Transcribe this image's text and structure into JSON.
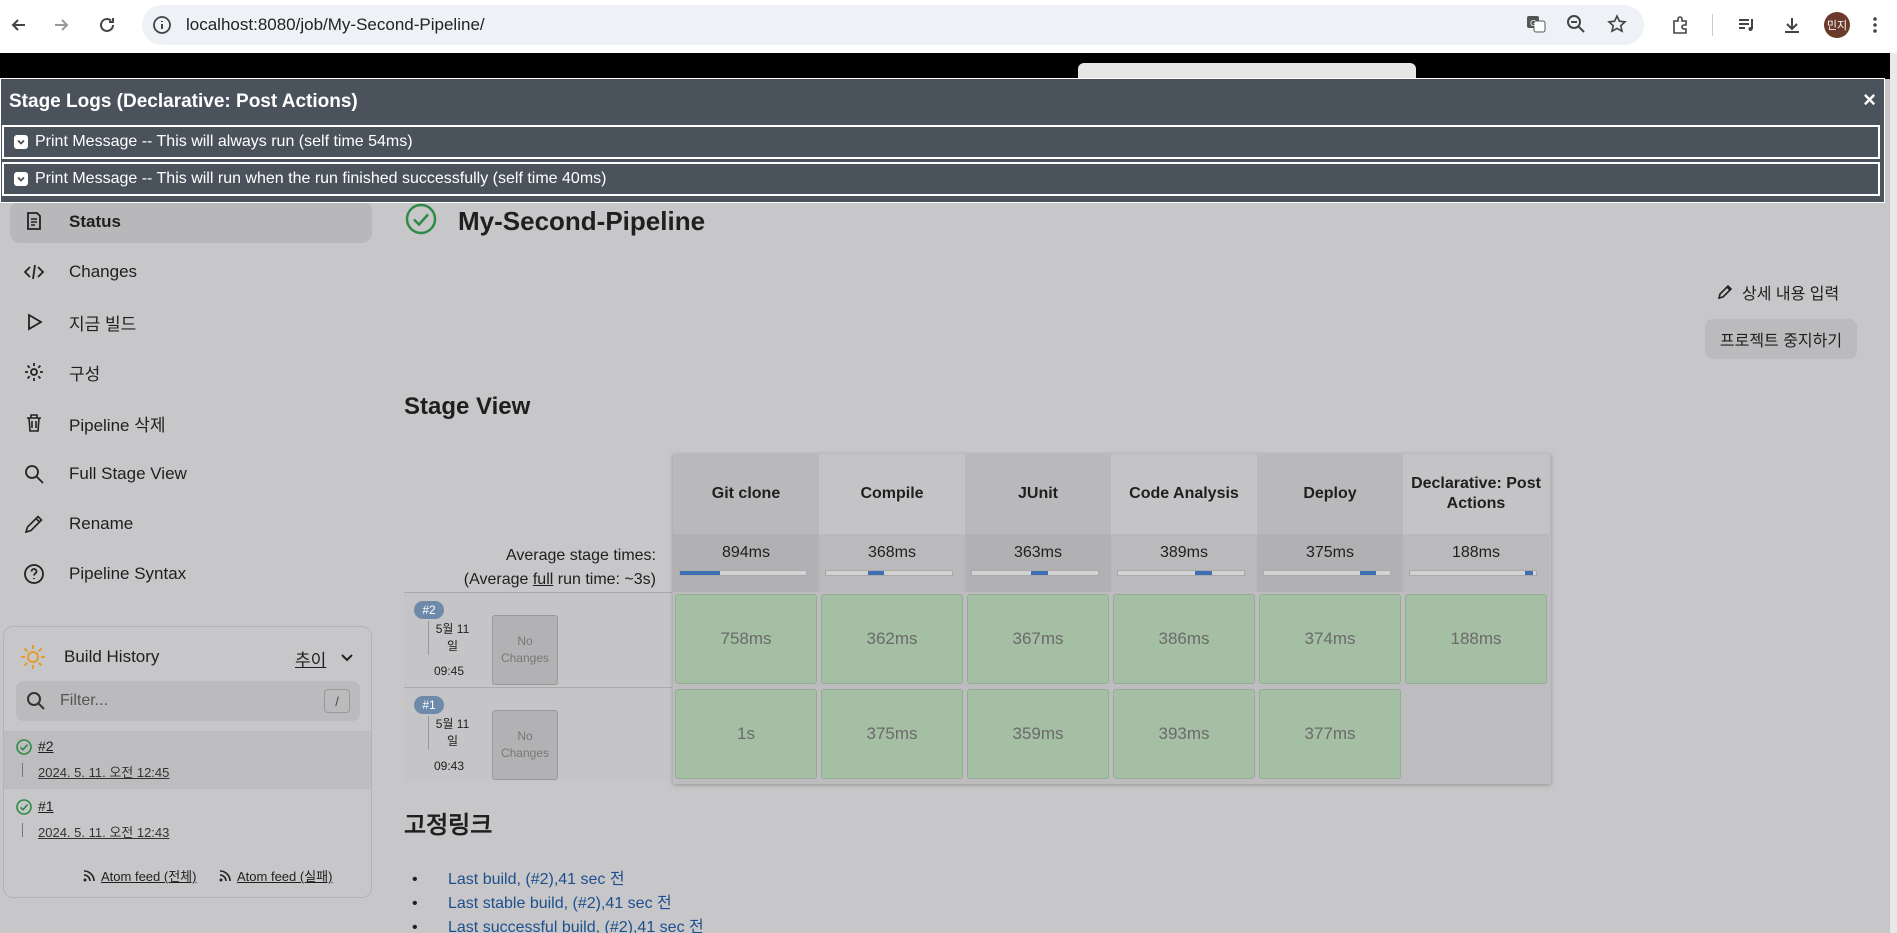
{
  "browser": {
    "url": "localhost:8080/job/My-Second-Pipeline/",
    "profile_label": "민지"
  },
  "dialog": {
    "title": "Stage Logs (Declarative: Post Actions)",
    "close_label": "×",
    "logs": [
      "Print Message -- This will always run (self time 54ms)",
      "Print Message -- This will run when the run finished successfully (self time 40ms)"
    ]
  },
  "sidebar": {
    "items": [
      {
        "label": "Status",
        "icon": "document-icon"
      },
      {
        "label": "Changes",
        "icon": "code-icon"
      },
      {
        "label": "지금 빌드",
        "icon": "play-icon"
      },
      {
        "label": "구성",
        "icon": "gear-icon"
      },
      {
        "label": "Pipeline 삭제",
        "icon": "trash-icon"
      },
      {
        "label": "Full Stage View",
        "icon": "search-icon"
      },
      {
        "label": "Rename",
        "icon": "pencil-icon"
      },
      {
        "label": "Pipeline Syntax",
        "icon": "help-icon"
      }
    ]
  },
  "build_history": {
    "title": "Build History",
    "trend_label": "추이",
    "filter_placeholder": "Filter...",
    "filter_shortcut": "/",
    "builds": [
      {
        "number": "#2",
        "date": "2024. 5. 11. 오전 12:45"
      },
      {
        "number": "#1",
        "date": "2024. 5. 11. 오전 12:43"
      }
    ],
    "atom_all": "Atom feed (전체)",
    "atom_fail": "Atom feed (실패)"
  },
  "main": {
    "title": "My-Second-Pipeline",
    "edit_description": "상세 내용 입력",
    "disable_project": "프로젝트 중지하기",
    "stage_view_title": "Stage View",
    "avg_label_line1": "Average stage times:",
    "avg_label_prefix": "(Average ",
    "avg_label_full": "full",
    "avg_label_suffix": " run time: ~3s)",
    "stages": [
      {
        "name": "Git clone",
        "avg": "894ms",
        "bar_start": 0.0,
        "bar_len": 0.32
      },
      {
        "name": "Compile",
        "avg": "368ms",
        "bar_start": 0.33,
        "bar_len": 0.13
      },
      {
        "name": "JUnit",
        "avg": "363ms",
        "bar_start": 0.47,
        "bar_len": 0.13
      },
      {
        "name": "Code Analysis",
        "avg": "389ms",
        "bar_start": 0.61,
        "bar_len": 0.14
      },
      {
        "name": "Deploy",
        "avg": "375ms",
        "bar_start": 0.76,
        "bar_len": 0.13
      },
      {
        "name": "Declarative: Post Actions",
        "avg": "188ms",
        "bar_start": 0.91,
        "bar_len": 0.07
      }
    ],
    "runs": [
      {
        "badge": "#2",
        "date": "5월 11 일",
        "time": "09:45",
        "changes": "No Changes",
        "cells": [
          "758ms",
          "362ms",
          "367ms",
          "386ms",
          "374ms",
          "188ms"
        ]
      },
      {
        "badge": "#1",
        "date": "5월 11 일",
        "time": "09:43",
        "changes": "No Changes",
        "cells": [
          "1s",
          "375ms",
          "359ms",
          "393ms",
          "377ms",
          ""
        ]
      }
    ],
    "permalinks_title": "고정링크",
    "permalinks": [
      "Last build, (#2),41 sec 전",
      "Last stable build, (#2),41 sec 전",
      "Last successful build, (#2),41 sec 전"
    ]
  },
  "colors": {
    "success_green": "#2e8b47",
    "stage_cell": "#a5bfa4",
    "link_blue": "#1d4f8f",
    "dialog_bg": "#4a525c"
  }
}
